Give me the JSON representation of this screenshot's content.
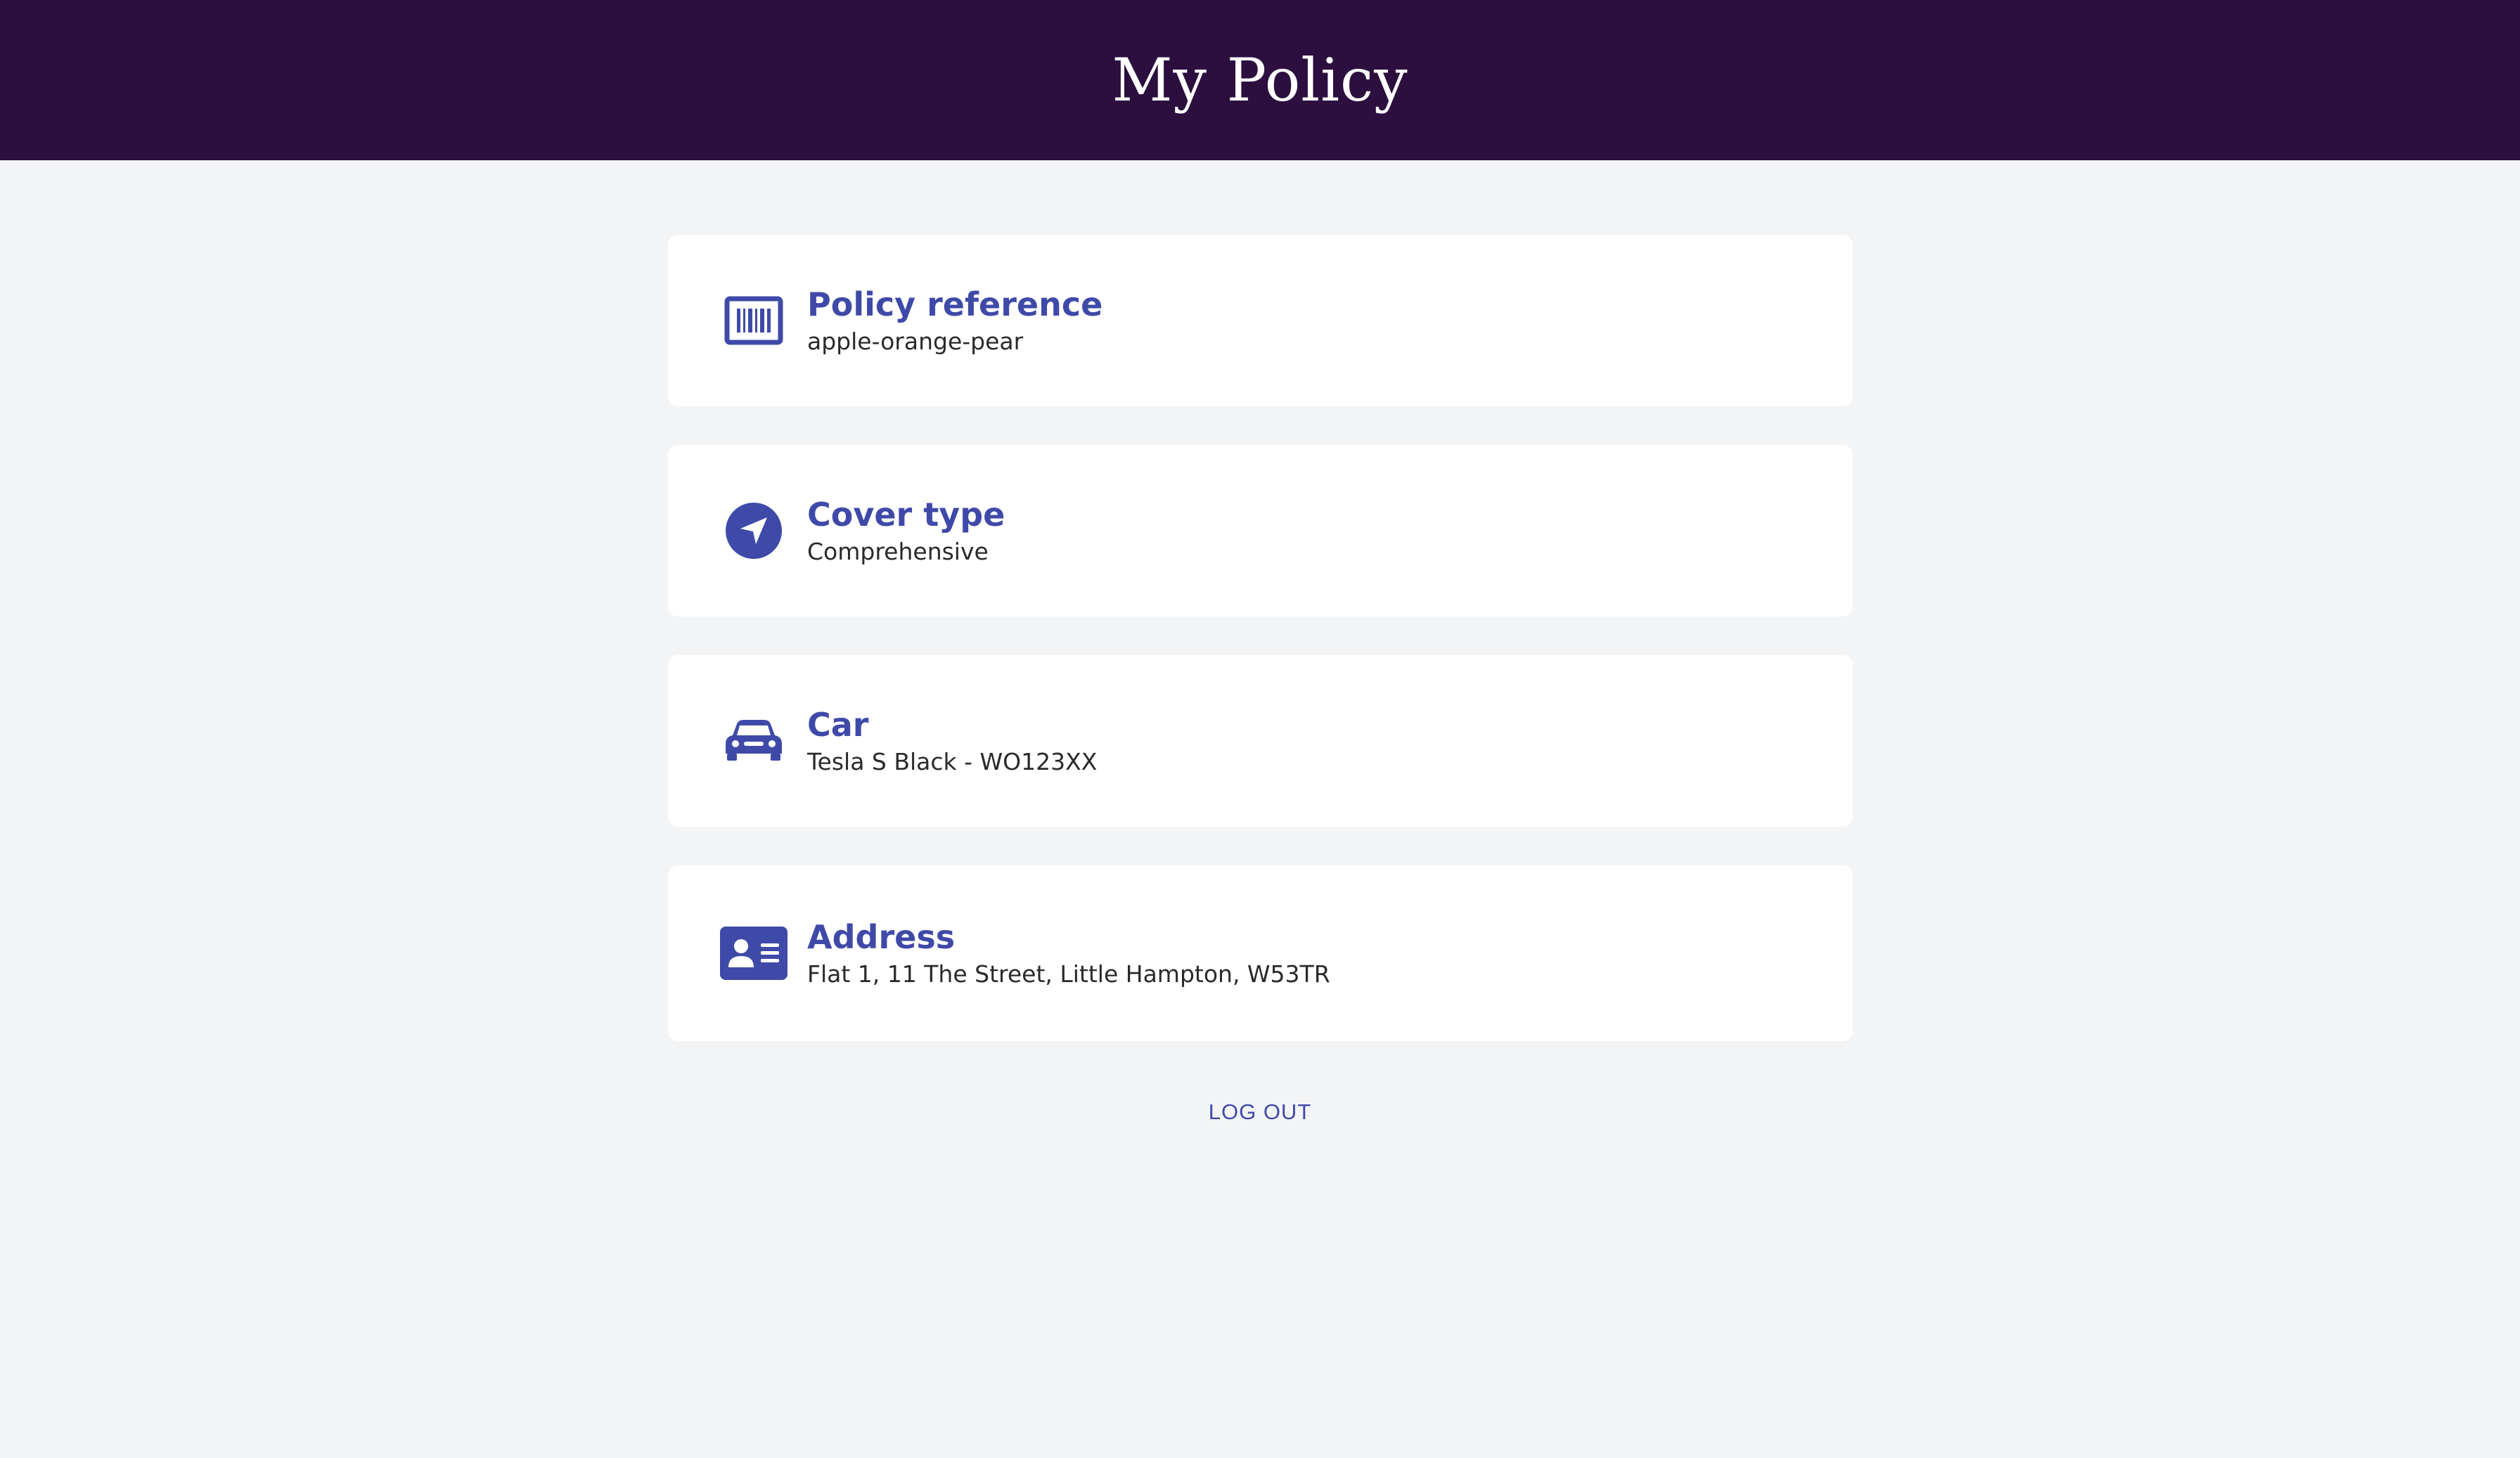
{
  "header": {
    "title": "My Policy"
  },
  "cards": [
    {
      "title": "Policy reference",
      "value": "apple-orange-pear",
      "icon": "barcode-icon"
    },
    {
      "title": "Cover type",
      "value": "Comprehensive",
      "icon": "navigation-arrow-icon"
    },
    {
      "title": "Car",
      "value": "Tesla S Black - WO123XX",
      "icon": "car-icon"
    },
    {
      "title": "Address",
      "value": "Flat 1, 11 The Street, Little Hampton, W53TR",
      "icon": "id-card-icon"
    }
  ],
  "actions": {
    "logout_label": "LOG OUT"
  },
  "colors": {
    "header_bg": "#2c0f3f",
    "accent": "#3f4aa8",
    "page_bg": "#f3f4f6"
  }
}
